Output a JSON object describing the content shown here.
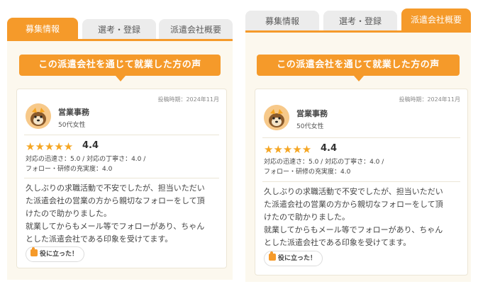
{
  "tabs": [
    "募集情報",
    "選考・登録",
    "派遣会社概要"
  ],
  "banner": "この派遣会社を通じて就業した方の声",
  "review": {
    "date": "投稿時期：2024年11月",
    "name": "営業事務",
    "sub": "50代女性",
    "stars": "★★★★★",
    "score": "4.4",
    "details_line1": "対応の迅速さ：5.0 / 対応の丁寧さ：4.0 /",
    "details_line2": "フォロー・研修の充実度：4.0",
    "left_text": [
      "久しぶりの求職活動で不安でしたが、担当いただい",
      "た派遣会社の営業の方から親切なフォローをして頂",
      "けたので助かりました。",
      "就業してからもメール等でフォローがあり、ちゃん",
      "とした派遣会社である印象を受けてます。"
    ],
    "right_text": [
      "久しぶりの求職活動で不安でしたが、担当いただい",
      "た派遣会社の営業の方から親切なフォローをして頂",
      "けたので助かりました。",
      "就業してからもメール等でフォローがあり、ちゃん",
      "とした派遣会社である印象を受けてます。"
    ],
    "helpful": "役に立った！"
  },
  "colors": {
    "accent": "#f59a2a",
    "star": "#f5a623",
    "bg": "#fcf8ee"
  }
}
